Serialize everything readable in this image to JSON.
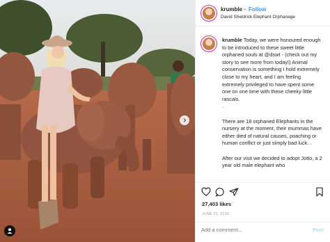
{
  "header": {
    "username": "krumble",
    "separator": "•",
    "follow_label": "Follow",
    "location": "David Sheldrick Elephant Orphanage"
  },
  "caption": {
    "username": "krumble",
    "paragraphs": [
      "Today, we were honoured enough to be introduced to these sweet little orphaned souls at @dswt - (check out my story to see more from today!) Animal conservation is something I hold extremely close to my heart, and I am feeling extremely privileged to have spent some one on one time with these cheeky little rascals.",
      ".",
      "There are 18 orphaned Elephants in the nursery at the moment, their mummas have either died of natural causes, poaching or human conflict or just simply bad luck. .",
      "After our visit we decided to adopt Jotto, a 2 year old male elephant who"
    ]
  },
  "actions": {
    "icons": [
      "heart-icon",
      "comment-icon",
      "share-icon",
      "bookmark-icon"
    ],
    "likes": "27,403 likes",
    "date": "JUNE 21, 2018"
  },
  "comment": {
    "placeholder": "Add a comment...",
    "post_label": "Post"
  },
  "photo": {
    "user_tag_icon": "person-icon",
    "next_icon": "chevron-right-icon"
  },
  "colors": {
    "link": "#3897f0",
    "post_disabled": "#b3dbff",
    "muted": "#999999",
    "soil": "#b86a48",
    "elephant": "#8a4f38"
  }
}
